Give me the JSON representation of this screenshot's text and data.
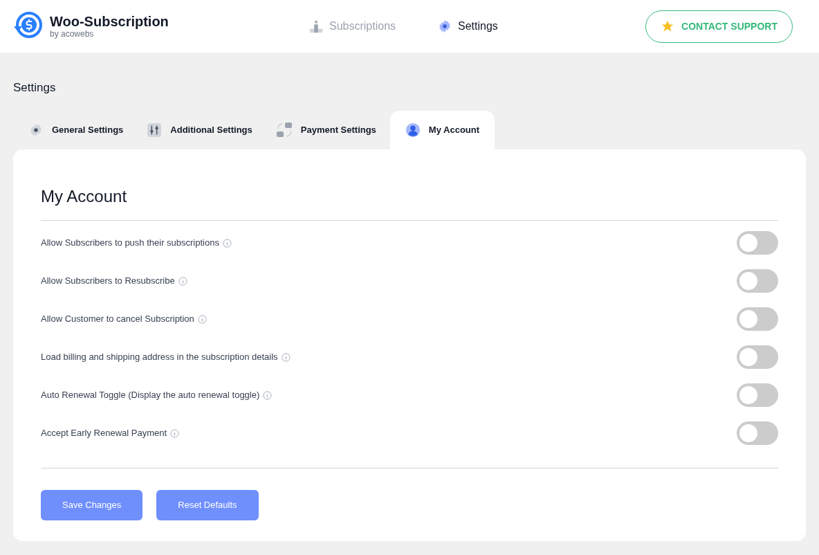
{
  "header": {
    "brand": "Woo-Subscription",
    "byline": "by acowebs",
    "nav": [
      {
        "label": "Subscriptions",
        "selected": false,
        "kind": "podium"
      },
      {
        "label": "Settings",
        "selected": true,
        "kind": "gear"
      }
    ],
    "support_button": "CONTACT SUPPORT"
  },
  "page_title": "Settings",
  "tabs": [
    {
      "label": "General Settings",
      "selected": false,
      "kind": "gear"
    },
    {
      "label": "Additional Settings",
      "selected": false,
      "kind": "sliders"
    },
    {
      "label": "Payment Settings",
      "selected": false,
      "kind": "swap"
    },
    {
      "label": "My Account",
      "selected": true,
      "kind": "user"
    }
  ],
  "panel": {
    "title": "My Account",
    "options": [
      {
        "label": "Allow Subscribers to push their subscriptions",
        "on": false
      },
      {
        "label": "Allow Subscribers to Resubscribe",
        "on": false
      },
      {
        "label": "Allow Customer to cancel Subscription",
        "on": false
      },
      {
        "label": "Load billing and shipping address in the subscription details",
        "on": false
      },
      {
        "label": "Auto Renewal Toggle (Display the auto renewal toggle)",
        "on": false
      },
      {
        "label": "Accept Early Renewal Payment",
        "on": false
      }
    ],
    "buttons": [
      "Save Changes",
      "Reset Defaults"
    ]
  }
}
